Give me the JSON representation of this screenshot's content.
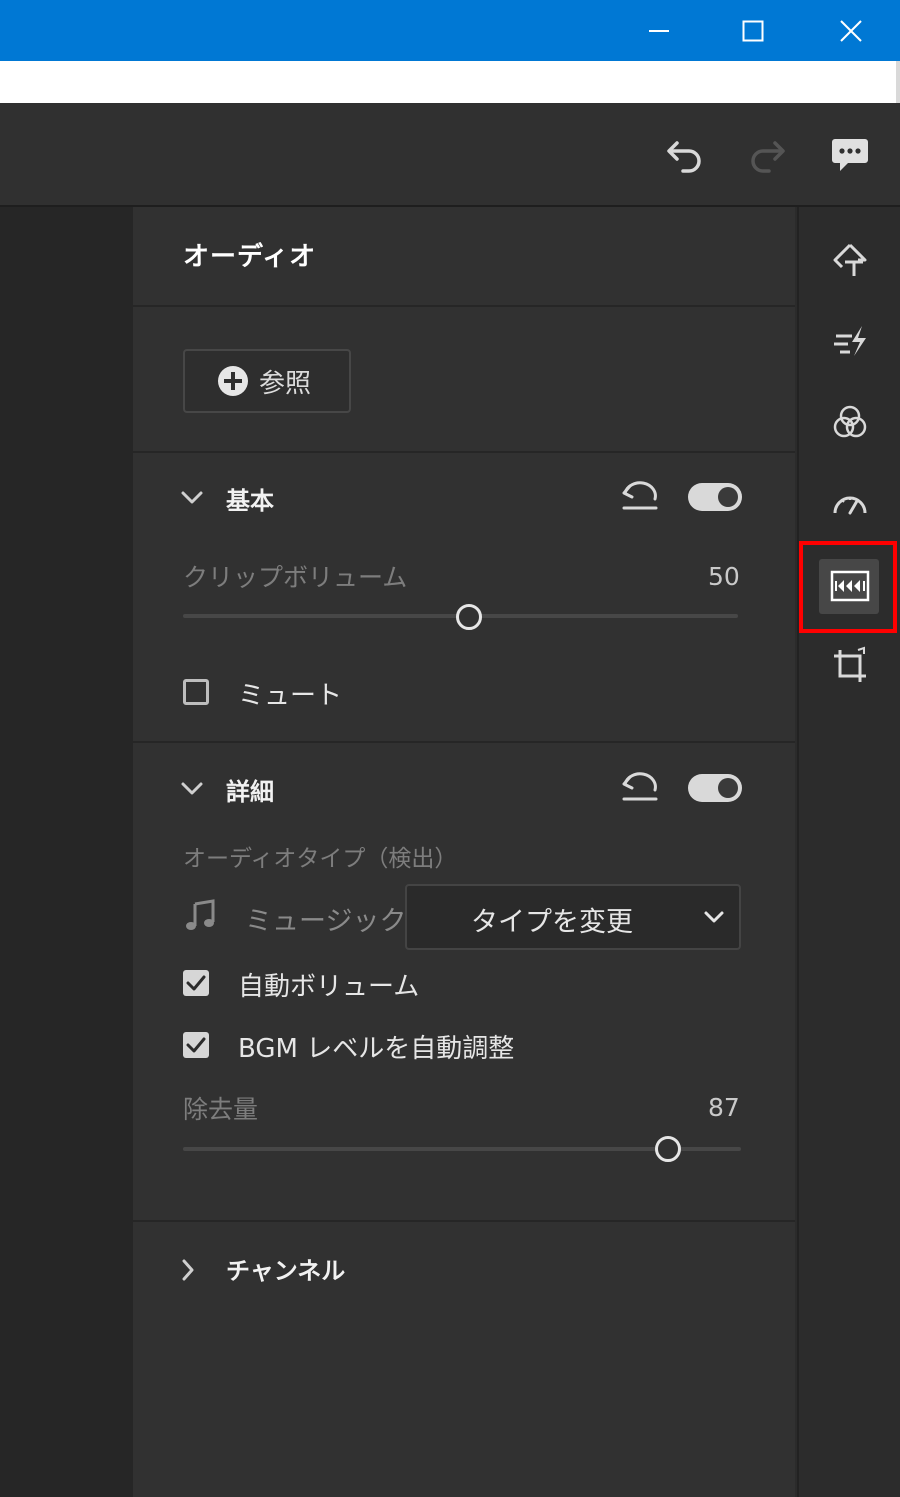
{
  "colors": {
    "titlebar": "#0078d4",
    "panel_bg": "#313131",
    "highlight": "#ff0000"
  },
  "window_controls": {
    "minimize_icon": "minimize-icon",
    "maximize_icon": "maximize-icon",
    "close_icon": "close-icon"
  },
  "toolbar": {
    "undo_icon": "undo-icon",
    "redo_icon": "redo-icon",
    "feedback_icon": "feedback-icon"
  },
  "panel": {
    "title": "オーディオ",
    "browse_label": "参照",
    "basic": {
      "title": "基本",
      "enabled": true,
      "clip_volume_label": "クリップボリューム",
      "clip_volume_value": "50",
      "clip_volume_fraction": 0.5,
      "mute_label": "ミュート",
      "mute_checked": false
    },
    "advanced": {
      "title": "詳細",
      "enabled": true,
      "audio_type_label": "オーディオタイプ（検出）",
      "detected_type": "ミュージック",
      "change_type_label": "タイプを変更",
      "auto_volume_label": "自動ボリューム",
      "auto_volume_checked": true,
      "bgm_label": "BGM レベルを自動調整",
      "bgm_checked": true,
      "removal_label": "除去量",
      "removal_value": "87",
      "removal_fraction": 0.87
    },
    "channel": {
      "title": "チャンネル"
    }
  },
  "sidebar": {
    "icons": [
      "title-icon",
      "transition-icon",
      "color-icon",
      "speed-icon",
      "audio-icon",
      "crop-icon"
    ],
    "active": "audio-icon"
  }
}
